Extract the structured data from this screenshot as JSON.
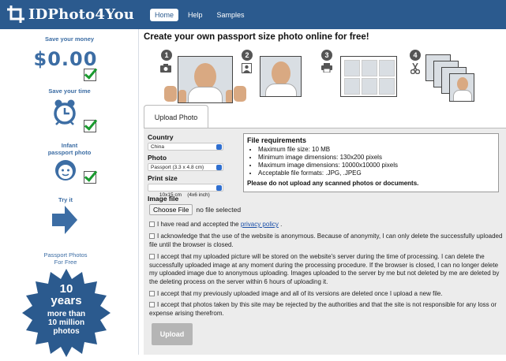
{
  "app": {
    "name": "IDPhoto4You"
  },
  "nav": {
    "home": "Home",
    "help": "Help",
    "samples": "Samples"
  },
  "sidebar": {
    "save_money": "Save your money",
    "price": "$0.00",
    "save_time": "Save your time",
    "infant_line1": "Infant",
    "infant_line2": "passport photo",
    "try_it": "Try it",
    "free_line1": "Passport Photos",
    "free_line2": "For Free",
    "badge": {
      "years": "10",
      "years_word": "years",
      "line1": "more than",
      "line2": "10 million",
      "line3": "photos"
    }
  },
  "main": {
    "headline": "Create your own passport size photo online for free!",
    "steps": [
      "1",
      "2",
      "3",
      "4"
    ]
  },
  "form": {
    "tab": "Upload Photo",
    "country_label": "Country",
    "country_value": "China",
    "photo_label": "Photo",
    "photo_value": "Passport (3.3 x 4.8 cm)",
    "print_label": "Print size",
    "print_value": "10x15 cm    (4x6 inch)",
    "image_label": "Image file",
    "choose_file": "Choose File",
    "no_file": "no file selected",
    "requirements": {
      "title": "File requirements",
      "items": [
        "Maximum file size: 10 MB",
        "Minimum image dimensions: 130x200 pixels",
        "Maximum image dimensions: 10000x10000 pixels",
        "Acceptable file formats: .JPG, .JPEG"
      ],
      "warning": "Please do not upload any scanned photos or documents."
    },
    "agreements": {
      "a1_pre": "I have read and accepted the ",
      "a1_link": "privacy policy",
      "a1_post": " .",
      "a2": "I acknowledge that the use of the website is anonymous. Because of anonymity, I can only delete the successfully uploaded file until the browser is closed.",
      "a3": "I accept that my uploaded picture will be stored on the website's server during the time of processing. I can delete the successfully uploaded image at any moment during the processing procedure. If the browser is closed, I can no longer delete my uploaded image due to anonymous uploading. Images uploaded to the server by me but not deleted by me are deleted by the deleting process on the server within 6 hours of uploading it.",
      "a4": "I accept that my previously uploaded image and all of its versions are deleted once I upload a new file.",
      "a5": "I accept that photos taken by this site may be rejected by the authorities and that the site is not responsible for any loss or expense arising therefrom."
    },
    "upload": "Upload"
  },
  "colors": {
    "brand": "#2b5a8e",
    "accent": "#3c6da4",
    "check": "#1a9a2f",
    "link": "#1a4fa8"
  },
  "icons": [
    "crop-logo-icon",
    "camera-icon",
    "portrait-icon",
    "printer-icon",
    "scissors-icon",
    "clock-icon",
    "baby-icon",
    "arrow-right-icon",
    "check-icon"
  ]
}
